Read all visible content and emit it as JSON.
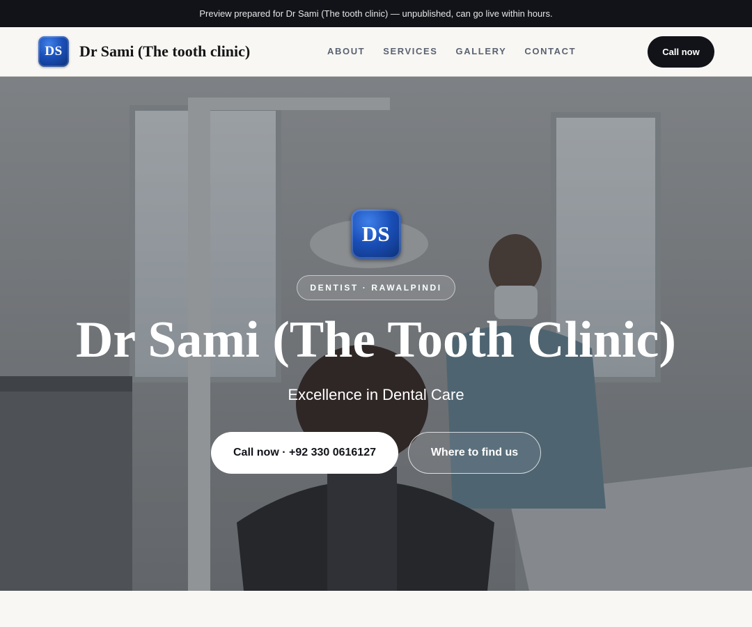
{
  "banner": {
    "text": "Preview prepared for Dr Sami (The tooth clinic) — unpublished, can go live within hours."
  },
  "header": {
    "logo_text": "DS",
    "brand_name": "Dr Sami (The tooth clinic)",
    "nav": [
      "ABOUT",
      "SERVICES",
      "GALLERY",
      "CONTACT"
    ],
    "cta_label": "Call now"
  },
  "hero": {
    "logo_text": "DS",
    "tag": "DENTIST · RAWALPINDI",
    "title": "Dr Sami (The Tooth Clinic)",
    "subtitle": "Excellence in Dental Care",
    "primary_button": "Call now · +92 330 0616127",
    "secondary_button": "Where to find us"
  },
  "colors": {
    "dark": "#111318",
    "logo_blue": "#1a4fb8",
    "page_bg": "#f8f7f4"
  }
}
